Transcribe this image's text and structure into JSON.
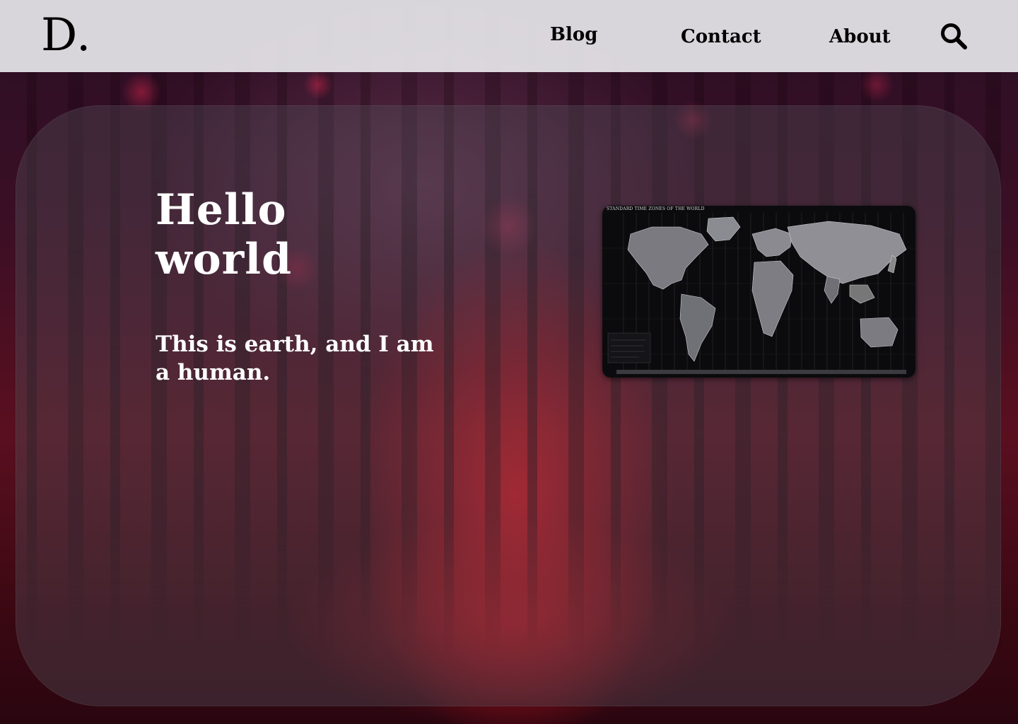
{
  "header": {
    "logo": "D.",
    "nav": [
      {
        "label": "Blog"
      },
      {
        "label": "Contact"
      },
      {
        "label": "About"
      }
    ],
    "search_icon": "search-icon"
  },
  "hero": {
    "headline_line1": "Hello",
    "headline_line2": "world",
    "subtitle": "This is earth, and I am a human."
  },
  "map_image": {
    "title": "STANDARD TIME ZONES OF THE WORLD"
  },
  "colors": {
    "header_bg": "#ECECF0",
    "text_on_header": "#000000",
    "text_on_card": "#FFFFFF",
    "accent_red": "#C8141E"
  }
}
